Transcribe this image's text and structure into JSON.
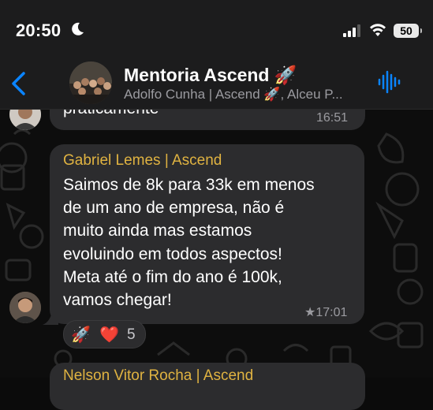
{
  "status_bar": {
    "time": "20:50",
    "battery": "50",
    "icons": [
      "moon-icon",
      "signal-icon",
      "wifi-icon",
      "battery-icon"
    ]
  },
  "header": {
    "title": "Mentoria Ascend 🚀",
    "subtitle": "Adolfo Cunha | Ascend 🚀, Alceu P...",
    "icons": [
      "back-icon",
      "voice-chat-icon"
    ],
    "accent_color": "#0a84ff"
  },
  "messages": [
    {
      "text": "praticamente",
      "time": "16:51"
    },
    {
      "sender": "Gabriel Lemes | Ascend",
      "sender_color": "#e0b341",
      "lines": [
        "Saimos de 8k para 33k em menos",
        "de um ano de empresa, não é",
        "muito ainda mas estamos",
        "evoluindo em todos aspectos!",
        "Meta até o fim do ano é 100k,",
        "vamos chegar!"
      ],
      "time": "★17:01",
      "reactions": {
        "rocket": "🚀",
        "heart": "❤️",
        "count": "5"
      }
    },
    {
      "sender": "Nelson Vitor Rocha | Ascend"
    }
  ]
}
